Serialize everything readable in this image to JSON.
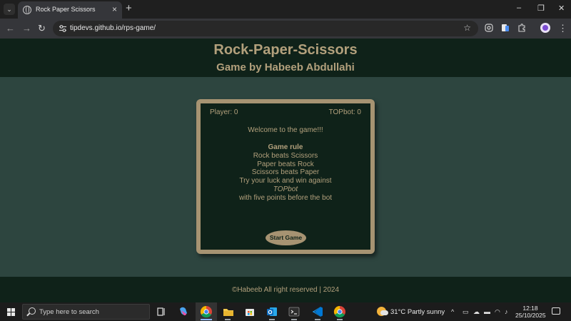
{
  "browser": {
    "tab_title": "Rock Paper Scissors",
    "tab_close": "×",
    "new_tab": "+",
    "url": "tipdevs.github.io/rps-game/",
    "window_controls": {
      "minimize": "–",
      "restore": "❐",
      "close": "✕"
    },
    "nav": {
      "back": "←",
      "forward": "→",
      "reload": "↻"
    },
    "star": "☆"
  },
  "page": {
    "title": "Rock-Paper-Scissors",
    "subtitle": "Game by Habeeb Abdullahi",
    "game": {
      "player_score": "Player: 0",
      "bot_score": "TOPbot: 0",
      "welcome": "Welcome to the game!!!",
      "rule_title": "Game rule",
      "rules": [
        "Rock beats Scissors",
        "Paper beats Rock",
        "Scissors beats Paper",
        "Try your luck and win against"
      ],
      "bot_name": "TOPbot",
      "rule_end": "with five points before the bot",
      "start_button": "Start Game"
    },
    "footer": "©Habeeb All right reserved | 2024"
  },
  "taskbar": {
    "search_placeholder": "Type here to search",
    "weather": "31°C  Partly sunny",
    "time": "12:18",
    "date": "25/10/2025",
    "tray_chevron": "^"
  },
  "colors": {
    "header_bg": "#0f2219",
    "page_bg": "#2d453f",
    "accent": "#b2a07c",
    "border": "#a69372"
  }
}
